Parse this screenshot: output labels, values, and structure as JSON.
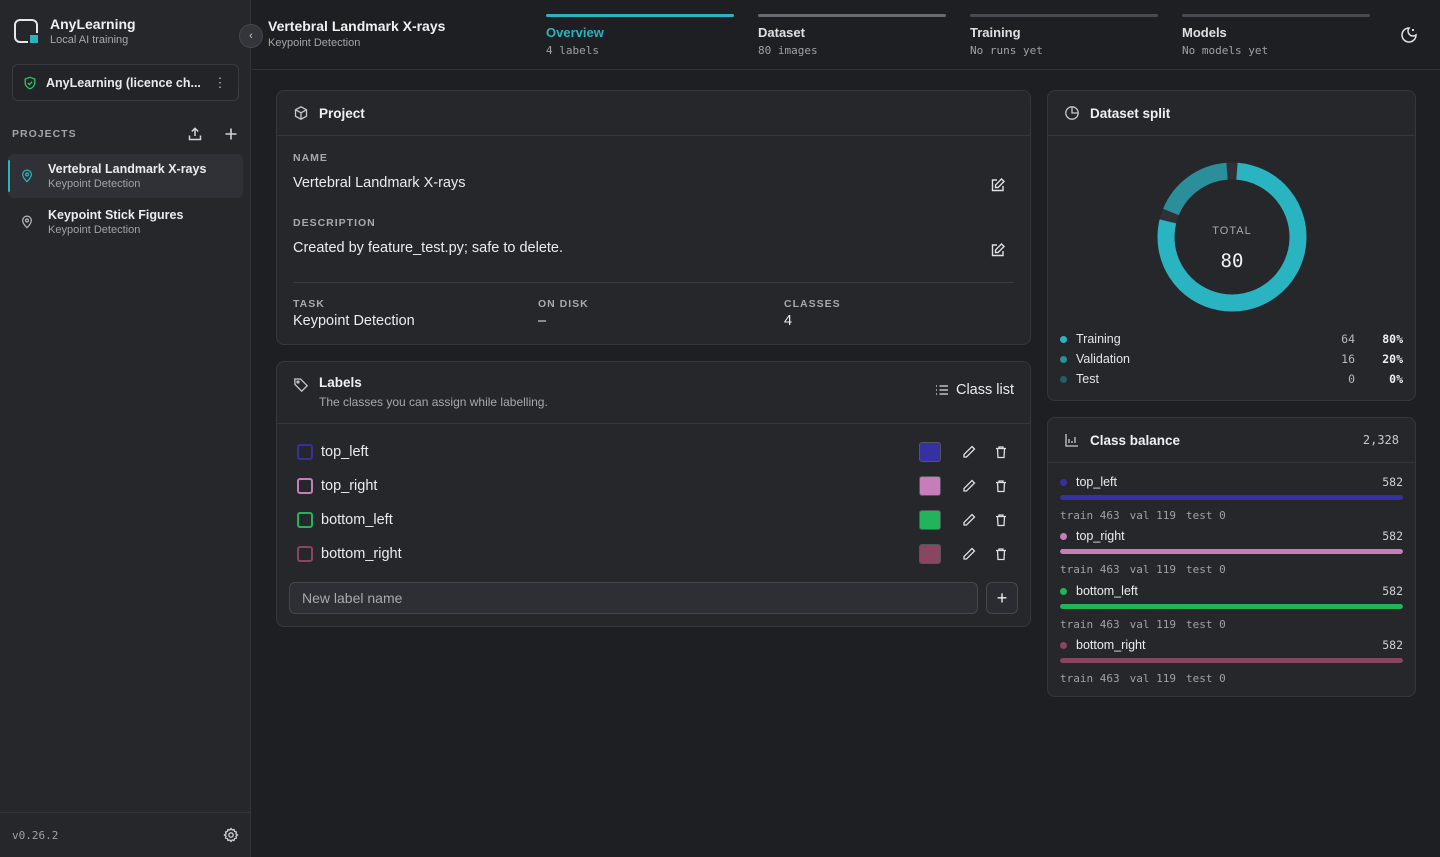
{
  "app": {
    "name": "AnyLearning",
    "subtitle": "Local AI training",
    "version": "v0.26.2"
  },
  "licence": {
    "label": "AnyLearning (licence ch..."
  },
  "sidebar": {
    "projects_label": "PROJECTS",
    "projects": [
      {
        "name": "Vertebral Landmark X-rays",
        "task": "Keypoint Detection"
      },
      {
        "name": "Keypoint Stick Figures",
        "task": "Keypoint Detection"
      }
    ]
  },
  "header": {
    "title": "Vertebral Landmark X-rays",
    "subtitle": "Keypoint Detection"
  },
  "steps": [
    {
      "label": "Overview",
      "sub": "4 labels"
    },
    {
      "label": "Dataset",
      "sub": "80 images"
    },
    {
      "label": "Training",
      "sub": "No runs yet"
    },
    {
      "label": "Models",
      "sub": "No models yet"
    }
  ],
  "project_card": {
    "title": "Project",
    "name_label": "NAME",
    "name": "Vertebral Landmark X-rays",
    "description_label": "DESCRIPTION",
    "description": "Created by feature_test.py; safe to delete.",
    "task_label": "TASK",
    "task": "Keypoint Detection",
    "disk_label": "ON DISK",
    "disk": "–",
    "classes_label": "CLASSES",
    "classes": "4"
  },
  "labels_card": {
    "title": "Labels",
    "subtitle": "The classes you can assign while labelling.",
    "class_list_button": "Class list",
    "new_label_placeholder": "New label name",
    "labels": [
      {
        "name": "top_left",
        "color": "#3730a3"
      },
      {
        "name": "top_right",
        "color": "#c77dba"
      },
      {
        "name": "bottom_left",
        "color": "#22b45a"
      },
      {
        "name": "bottom_right",
        "color": "#8a4560"
      }
    ]
  },
  "split_card": {
    "title": "Dataset split",
    "total_label": "TOTAL",
    "total": "80",
    "rows": [
      {
        "name": "Training",
        "count": "64",
        "pct": "80%",
        "color": "#2ab3c0",
        "value": 64
      },
      {
        "name": "Validation",
        "count": "16",
        "pct": "20%",
        "color": "#2a8e9b",
        "value": 16
      },
      {
        "name": "Test",
        "count": "0",
        "pct": "0%",
        "color": "#245d66",
        "value": 0
      }
    ]
  },
  "balance_card": {
    "title": "Class balance",
    "total": "2,328",
    "rows": [
      {
        "name": "top_left",
        "value": "582",
        "fraction": 1.0,
        "color": "#3730a3",
        "train": "train 463",
        "val": "val 119",
        "test": "test 0"
      },
      {
        "name": "top_right",
        "value": "582",
        "fraction": 1.0,
        "color": "#c77dba",
        "train": "train 463",
        "val": "val 119",
        "test": "test 0"
      },
      {
        "name": "bottom_left",
        "value": "582",
        "fraction": 1.0,
        "color": "#22b45a",
        "train": "train 463",
        "val": "val 119",
        "test": "test 0"
      },
      {
        "name": "bottom_right",
        "value": "582",
        "fraction": 1.0,
        "color": "#8a4560",
        "train": "train 463",
        "val": "val 119",
        "test": "test 0"
      }
    ]
  },
  "colors": {
    "accent": "#2ab3c0",
    "background": "#1e1f22",
    "panel": "#26272b"
  }
}
